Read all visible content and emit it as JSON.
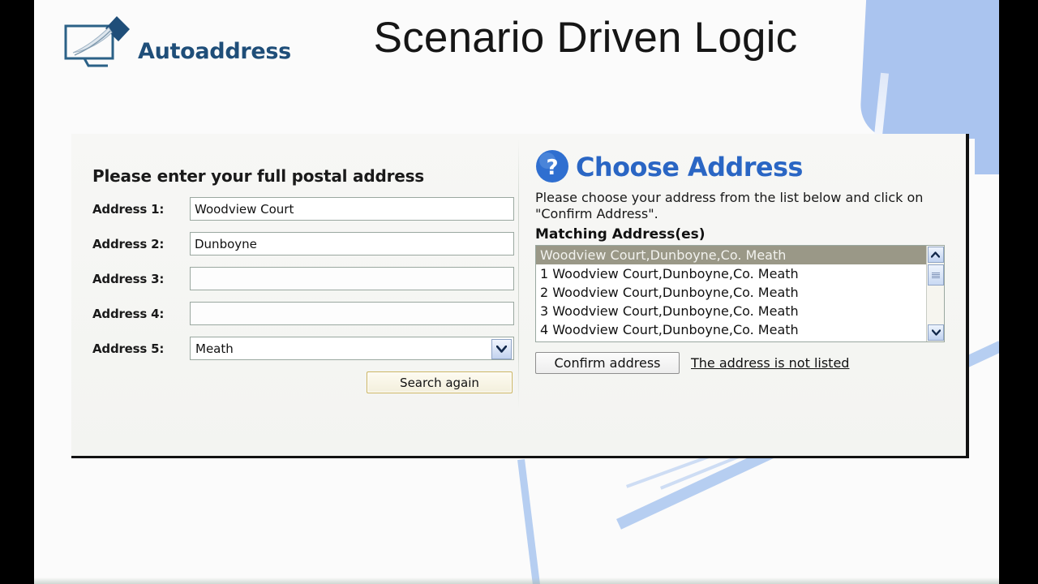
{
  "header": {
    "logo_text": "Autoaddress",
    "logo_icon": "monitor-with-page-icon",
    "page_title": "Scenario Driven Logic"
  },
  "form": {
    "heading": "Please enter your full postal address",
    "fields": [
      {
        "label": "Address 1:",
        "value": "Woodview Court",
        "type": "text"
      },
      {
        "label": "Address 2:",
        "value": "Dunboyne",
        "type": "text"
      },
      {
        "label": "Address 3:",
        "value": "",
        "type": "text"
      },
      {
        "label": "Address 4:",
        "value": "",
        "type": "text"
      },
      {
        "label": "Address 5:",
        "value": "Meath",
        "type": "select"
      }
    ],
    "search_button": "Search again"
  },
  "choose": {
    "icon": "question-mark-circle-icon",
    "title": "Choose Address",
    "description": "Please choose your address from the list below and click on \"Confirm Address\".",
    "list_label": "Matching Address(es)",
    "items": [
      "Woodview Court,Dunboyne,Co. Meath",
      "1 Woodview Court,Dunboyne,Co. Meath",
      "2 Woodview Court,Dunboyne,Co. Meath",
      "3 Woodview Court,Dunboyne,Co. Meath",
      "4 Woodview Court,Dunboyne,Co. Meath"
    ],
    "selected_index": 0,
    "confirm_button": "Confirm address",
    "not_listed_link": "The address is not listed",
    "scrollbar": {
      "up_icon": "chevron-up-icon",
      "down_icon": "chevron-down-icon",
      "thumb_icon": "scroll-thumb-grip"
    }
  },
  "colors": {
    "brand_blue": "#1f4e79",
    "title_blue": "#2a66c4",
    "selection_bg": "#9a9887",
    "deco_blue": "#aac4ef",
    "gold_button_border": "#cbb45f"
  }
}
